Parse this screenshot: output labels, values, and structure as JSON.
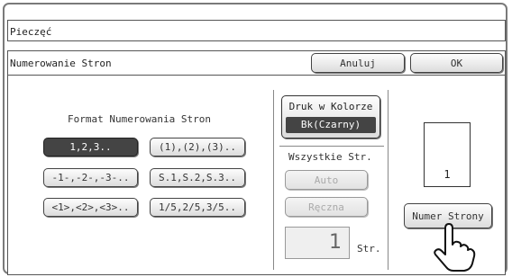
{
  "title": "Pieczęć",
  "subheader": {
    "label": "Numerowanie Stron",
    "cancel_label": "Anuluj",
    "ok_label": "OK"
  },
  "format": {
    "heading": "Format Numerowania Stron",
    "options": [
      {
        "label": "1,2,3..",
        "selected": true
      },
      {
        "label": "(1),(2),(3)..",
        "selected": false
      },
      {
        "label": "-1-,-2-,-3-..",
        "selected": false
      },
      {
        "label": "S.1,S.2,S.3..",
        "selected": false
      },
      {
        "label": "<1>,<2>,<3>..",
        "selected": false
      },
      {
        "label": "1/5,2/5,3/5..",
        "selected": false
      }
    ]
  },
  "color": {
    "label": "Druk w Kolorze",
    "value": "Bk(Czarny)"
  },
  "pages": {
    "heading": "Wszystkie Str.",
    "auto_label": "Auto",
    "manual_label": "Ręczna",
    "count_value": "1",
    "count_unit": "Str."
  },
  "preview": {
    "page_number": "1",
    "button_label": "Numer Strony"
  },
  "colors": {
    "selected_bg": "#444444",
    "border": "#555555"
  },
  "icons": [
    "pointing-hand-icon"
  ]
}
